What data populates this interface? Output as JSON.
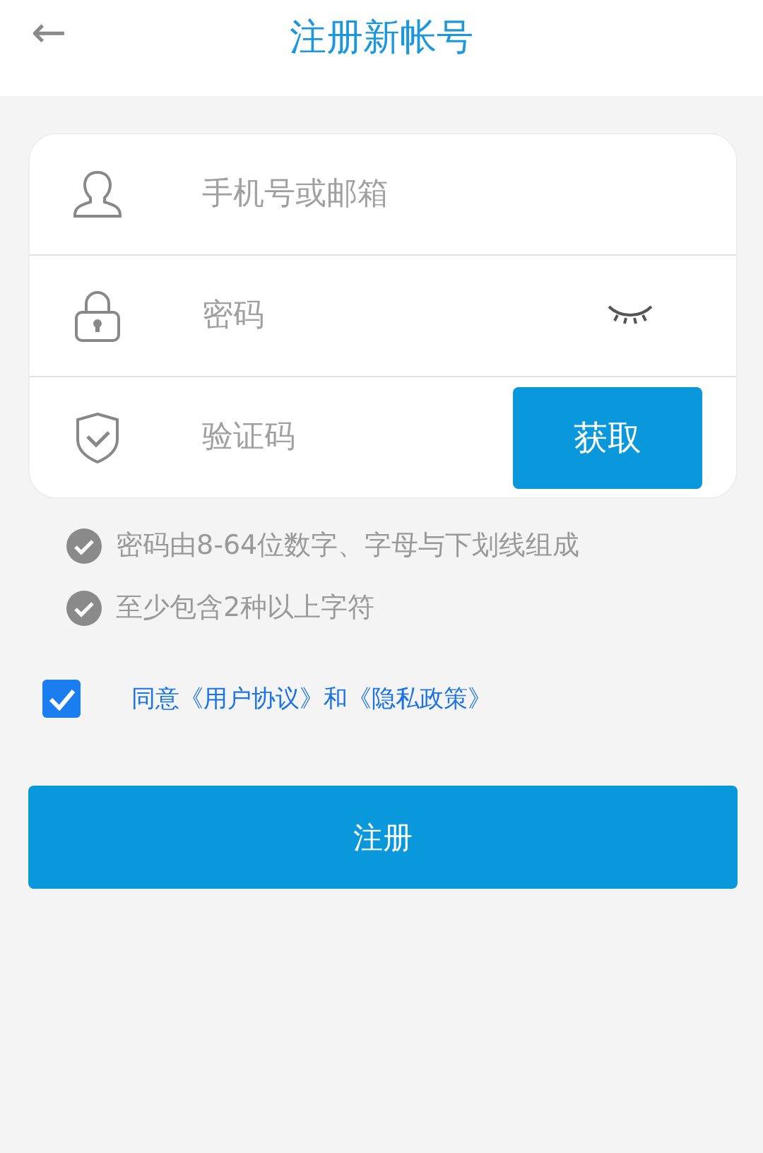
{
  "header": {
    "back": "←",
    "title": "注册新帐号"
  },
  "fields": [
    {
      "kind": "account",
      "placeholder": "手机号或邮箱"
    },
    {
      "kind": "password",
      "placeholder": "密码",
      "password_visible": false
    },
    {
      "kind": "code",
      "placeholder": "验证码",
      "button": "获取"
    }
  ],
  "rules": [
    {
      "text": "密码由8-64位数字、字母与下划线组成"
    },
    {
      "text": "至少包含2种以上字符"
    }
  ],
  "agreement": {
    "checked": true,
    "text": "同意《用户协议》和《隐私政策》"
  },
  "submit": "注册"
}
